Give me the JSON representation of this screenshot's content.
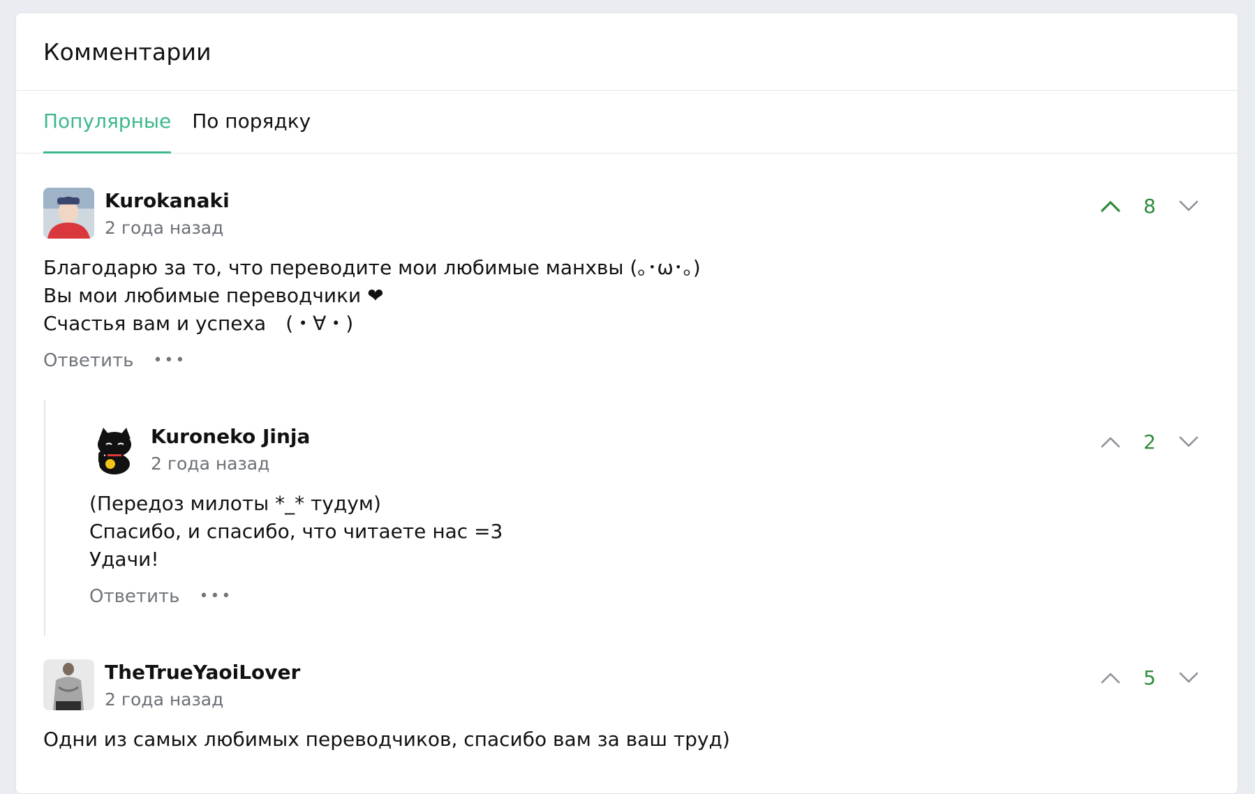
{
  "header": {
    "title": "Комментарии"
  },
  "tabs": [
    {
      "label": "Популярные",
      "active": true
    },
    {
      "label": "По порядку",
      "active": false
    }
  ],
  "accent_color": "#3cb88a",
  "vote_color": "#2e8b3b",
  "comments": [
    {
      "author": "Kurokanaki",
      "time": "2 года назад",
      "lines": [
        "Благодарю за то, что переводите мои любимые манхвы (｡･ω･｡)",
        "Вы мои любимые переводчики ❤",
        "Счастья вам и успеха　(・∀・)"
      ],
      "votes": "8",
      "upvoted": true,
      "reply_label": "Ответить",
      "more_label": "•••"
    },
    {
      "author": "Kuroneko Jinja",
      "time": "2 года назад",
      "lines": [
        "(Передоз милоты *_* тудум)",
        "Спасибо, и спасибо, что читаете нас =3",
        "Удачи!"
      ],
      "votes": "2",
      "upvoted": false,
      "reply_label": "Ответить",
      "more_label": "•••"
    },
    {
      "author": "TheTrueYaoiLover",
      "time": "2 года назад",
      "lines": [
        "Одни из самых любимых переводчиков, спасибо вам за ваш труд)"
      ],
      "votes": "5",
      "upvoted": false
    }
  ]
}
